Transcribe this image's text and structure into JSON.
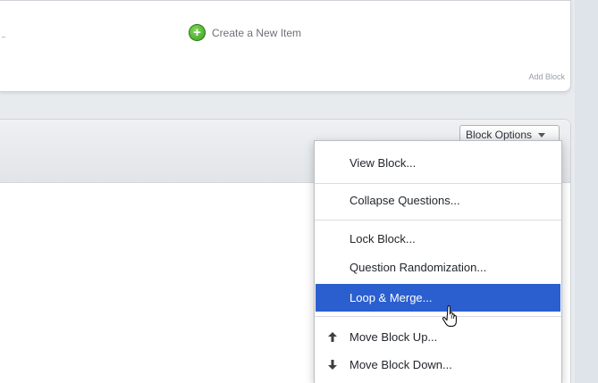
{
  "top_block": {
    "create_item_label": "Create a New Item",
    "add_block_label": "Add Block"
  },
  "block": {
    "options_label": "Block Options"
  },
  "menu": {
    "items": [
      {
        "label": "View Block..."
      },
      {
        "label": "Collapse Questions..."
      },
      {
        "label": "Lock Block..."
      },
      {
        "label": "Question Randomization..."
      },
      {
        "label": "Loop & Merge...",
        "highlighted": true
      },
      {
        "label": "Move Block Up...",
        "icon": "arrow-up-icon"
      },
      {
        "label": "Move Block Down...",
        "icon": "arrow-down-icon"
      }
    ]
  },
  "colors": {
    "highlight": "#2b5fcf",
    "add_icon": "#4caf2a"
  },
  "icons": {
    "create": "plus-circle-icon",
    "dropdown": "caret-down-icon",
    "cursor": "hand-pointer-cursor-icon"
  }
}
